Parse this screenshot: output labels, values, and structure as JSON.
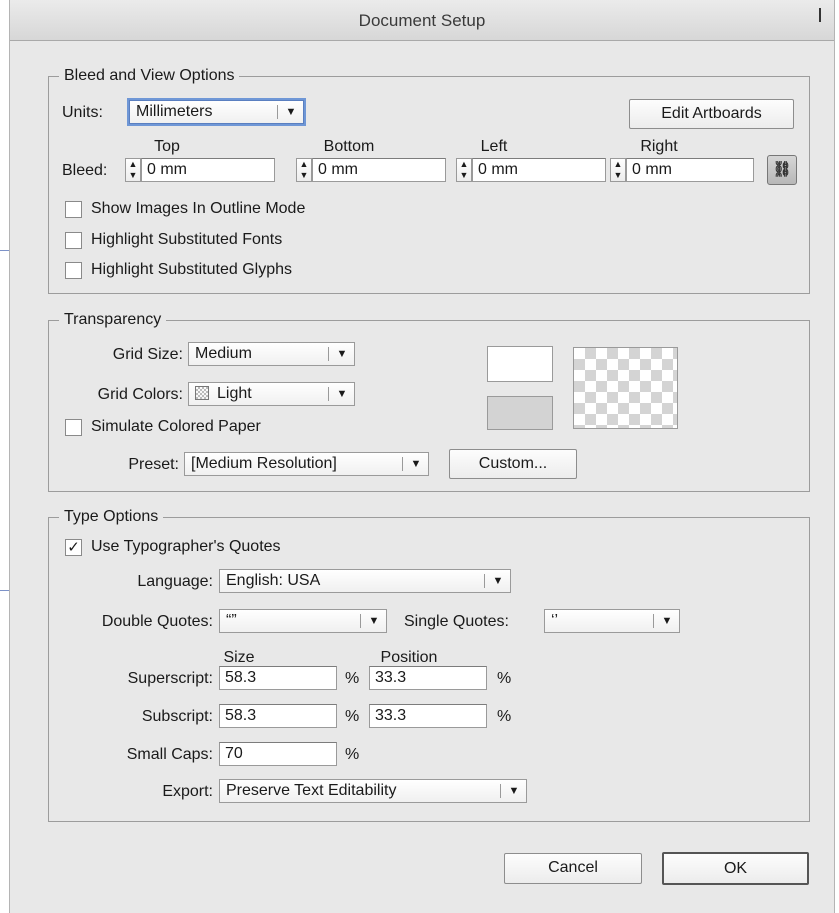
{
  "window": {
    "title": "Document Setup"
  },
  "bleed_view": {
    "legend": "Bleed and View Options",
    "units_label": "Units:",
    "units_value": "Millimeters",
    "edit_artboards_label": "Edit Artboards",
    "bleed_label": "Bleed:",
    "headers": {
      "top": "Top",
      "bottom": "Bottom",
      "left": "Left",
      "right": "Right"
    },
    "values": {
      "top": "0 mm",
      "bottom": "0 mm",
      "left": "0 mm",
      "right": "0 mm"
    },
    "link_icon": "chain-link-icon",
    "checkboxes": [
      {
        "label": "Show Images In Outline Mode",
        "checked": false
      },
      {
        "label": "Highlight Substituted Fonts",
        "checked": false
      },
      {
        "label": "Highlight Substituted Glyphs",
        "checked": false
      }
    ]
  },
  "transparency": {
    "legend": "Transparency",
    "grid_size_label": "Grid Size:",
    "grid_size_value": "Medium",
    "grid_colors_label": "Grid Colors:",
    "grid_colors_value": "Light",
    "simulate_label": "Simulate Colored Paper",
    "simulate_checked": false,
    "preset_label": "Preset:",
    "preset_value": "[Medium Resolution]",
    "custom_label": "Custom...",
    "swatch_colors": {
      "top": "#ffffff",
      "bottom": "#d3d3d3"
    }
  },
  "type_options": {
    "legend": "Type Options",
    "typographers_label": "Use Typographer's Quotes",
    "typographers_checked": true,
    "check_mark": "✓",
    "language_label": "Language:",
    "language_value": "English: USA",
    "double_quotes_label": "Double Quotes:",
    "double_quotes_value": "“”",
    "single_quotes_label": "Single Quotes:",
    "single_quotes_value": "‘’",
    "size_header": "Size",
    "position_header": "Position",
    "superscript_label": "Superscript:",
    "superscript_size": "58.3",
    "superscript_position": "33.3",
    "subscript_label": "Subscript:",
    "subscript_size": "58.3",
    "subscript_position": "33.3",
    "small_caps_label": "Small Caps:",
    "small_caps_value": "70",
    "percent": "%",
    "export_label": "Export:",
    "export_value": "Preserve Text Editability"
  },
  "footer": {
    "cancel_label": "Cancel",
    "ok_label": "OK"
  },
  "icons": {
    "dropdown_arrow": "▼",
    "stepper_up": "▲",
    "stepper_down": "▼",
    "link": "⛓"
  }
}
